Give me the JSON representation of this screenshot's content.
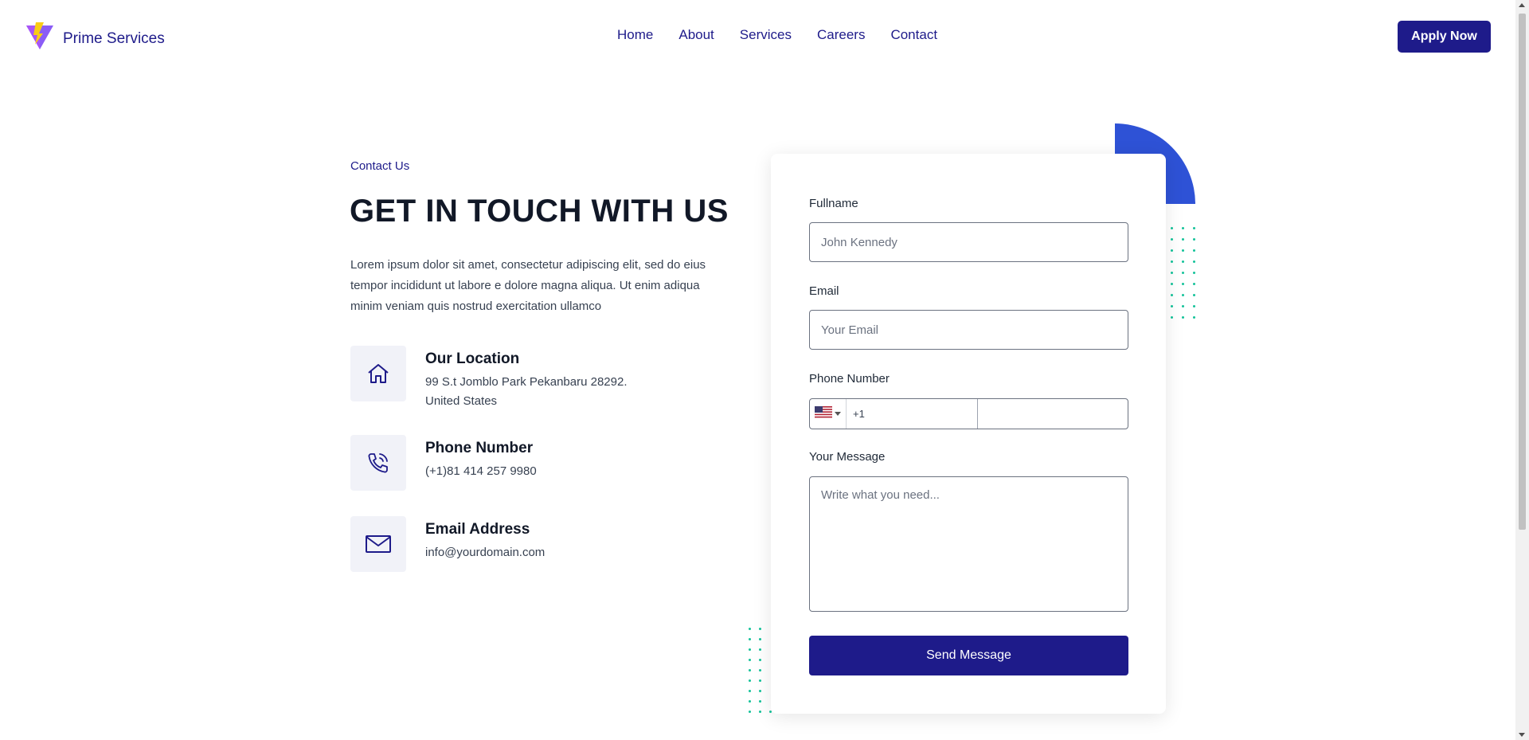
{
  "header": {
    "brand_name": "Prime Services",
    "nav": [
      "Home",
      "About",
      "Services",
      "Careers",
      "Contact"
    ],
    "apply_label": "Apply Now"
  },
  "contact": {
    "eyebrow": "Contact Us",
    "title": "GET IN TOUCH WITH US",
    "intro": "Lorem ipsum dolor sit amet, consectetur adipiscing elit, sed do eius tempor incididunt ut labore e dolore magna aliqua. Ut enim adiqua minim veniam quis nostrud exercitation ullamco",
    "location": {
      "title": "Our Location",
      "line1": "99 S.t Jomblo Park Pekanbaru 28292.",
      "line2": "United States"
    },
    "phone": {
      "title": "Phone Number",
      "value": "(+1)81 414 257 9980"
    },
    "email": {
      "title": "Email Address",
      "value": "info@yourdomain.com"
    }
  },
  "form": {
    "fullname_label": "Fullname",
    "fullname_placeholder": "John Kennedy",
    "email_label": "Email",
    "email_placeholder": "Your Email",
    "phone_label": "Phone Number",
    "dial_code": "+1",
    "message_label": "Your Message",
    "message_placeholder": "Write what you need...",
    "submit_label": "Send Message"
  },
  "icons": {
    "logo": "logo-triangle-icon",
    "location": "home-icon",
    "phone": "phone-ringing-icon",
    "email": "envelope-icon",
    "flag": "us-flag-icon"
  },
  "colors": {
    "primary": "#1e1b8a",
    "accent_blue": "#2e52d6",
    "accent_green": "#15c39a"
  }
}
